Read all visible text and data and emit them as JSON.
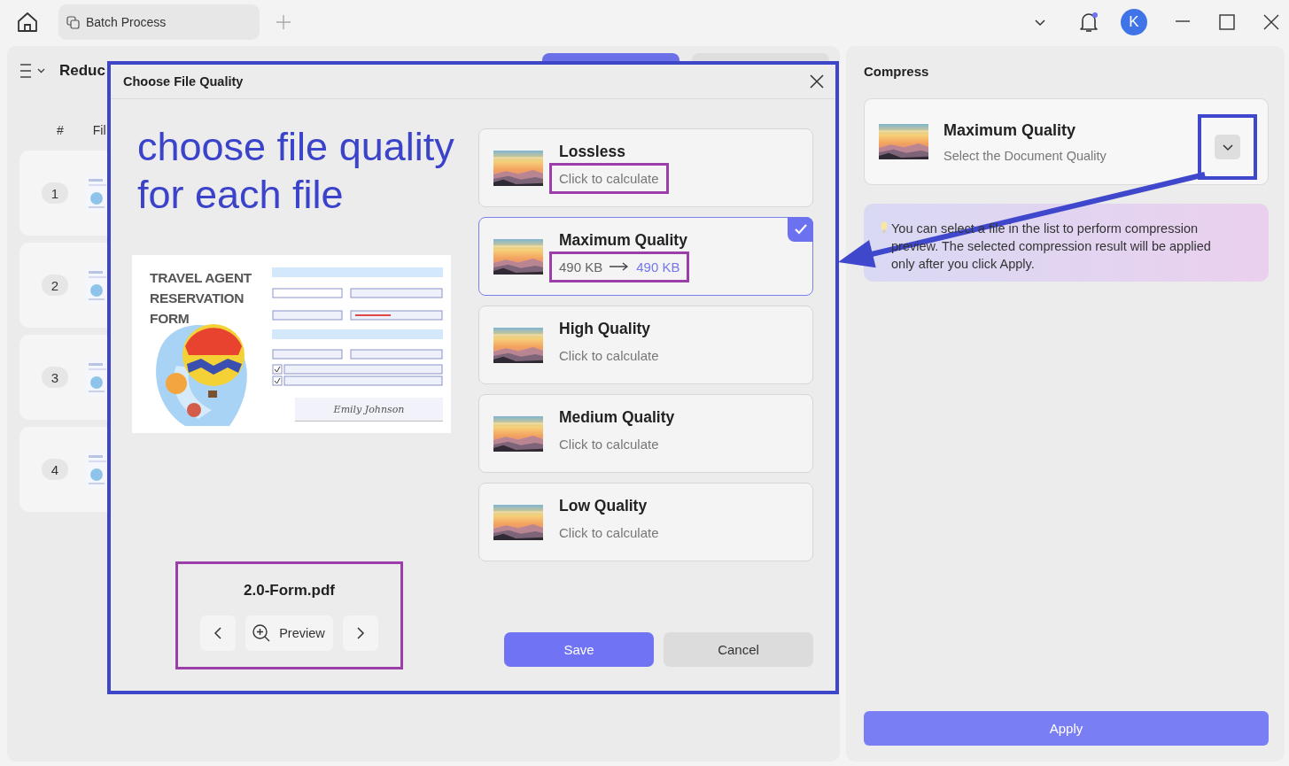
{
  "top_bar": {
    "tabs": [
      {
        "label": "Batch Process",
        "selected": true
      }
    ],
    "avatar": "K"
  },
  "main": {
    "title": "Reduc",
    "columns": [
      "#",
      "Fil"
    ],
    "files": [
      {
        "number": "1"
      },
      {
        "number": "2"
      },
      {
        "number": "3"
      },
      {
        "number": "4"
      }
    ]
  },
  "compress_panel": {
    "title": "Compress",
    "quality": {
      "title": "Maximum Quality",
      "subtitle": "Select the Document Quality",
      "highlighted": true
    },
    "hint": "You can select a file in the list to perform compression preview. The selected compression result will be applied only after you click Apply.",
    "apply": "Apply"
  },
  "dialog": {
    "title": "Choose File Quality",
    "annotation": "choose file quality for each file",
    "preview": {
      "form_title": "TRAVEL AGENT RESERVATION FORM",
      "signature": "Emily Johnson"
    },
    "file_box": {
      "file_name": "2.0-Form.pdf",
      "preview_label": "Preview",
      "highlighted": true
    },
    "options": [
      {
        "kind": "pending",
        "title": "Lossless",
        "detail": "Click to calculate",
        "selected": false,
        "highlighted": true
      },
      {
        "kind": "calculated",
        "title": "Maximum Quality",
        "original_size": "490 KB",
        "new_size": "490 KB",
        "selected": true,
        "highlighted": true
      },
      {
        "kind": "pending",
        "title": "High Quality",
        "detail": "Click to calculate",
        "selected": false,
        "highlighted": false
      },
      {
        "kind": "pending",
        "title": "Medium Quality",
        "detail": "Click to calculate",
        "selected": false,
        "highlighted": false
      },
      {
        "kind": "pending",
        "title": "Low Quality",
        "detail": "Click to calculate",
        "selected": false,
        "highlighted": false
      }
    ],
    "buttons": [
      {
        "label": "Save",
        "kind": "primary"
      },
      {
        "label": "Cancel",
        "kind": "secondary"
      }
    ]
  }
}
